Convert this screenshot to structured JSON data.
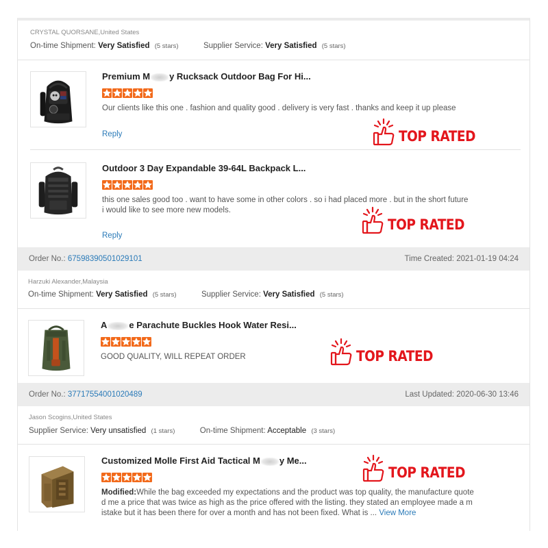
{
  "reviews": [
    {
      "reviewer": "CRYSTAL QUORSANE,United States",
      "ratings": [
        {
          "label": "On-time Shipment:",
          "value": "Very Satisfied",
          "stars": "(5 stars)"
        },
        {
          "label": "Supplier Service:",
          "value": "Very Satisfied",
          "stars": "(5 stars)"
        }
      ],
      "items": [
        {
          "title_a": "Premium M",
          "title_b": "y Rucksack Outdoor Bag For Hi...",
          "rating": 5,
          "text": "Our clients like this one . fashion and quality good .   delivery is very fast .  thanks and keep it up please",
          "reply": "Reply",
          "badge": "TOP RATED"
        },
        {
          "title": "Outdoor 3 Day Expandable 39-64L Backpack L...",
          "rating": 5,
          "text_line1": "this one sales good too .  want to have some in other colors . so i had placed more .  but in the short future",
          "text_line2": "i would like to see more new models.",
          "reply": "Reply",
          "badge": "TOP RATED"
        }
      ]
    },
    {
      "order_label": "Order No.:",
      "order_no": "67598390501029101",
      "time_label": "Time Created:",
      "time": "2021-01-19 04:24",
      "reviewer": "Harzuki Alexander,Malaysia",
      "ratings": [
        {
          "label": "On-time Shipment:",
          "value": "Very Satisfied",
          "stars": "(5 stars)"
        },
        {
          "label": "Supplier Service:",
          "value": "Very Satisfied",
          "stars": "(5 stars)"
        }
      ],
      "items": [
        {
          "title_a": "A",
          "title_b": "e Parachute Buckles Hook Water Resi...",
          "rating": 5,
          "text": "GOOD QUALITY, WILL REPEAT ORDER",
          "badge": "TOP RATED"
        }
      ]
    },
    {
      "order_label": "Order No.:",
      "order_no": "37717554001020489",
      "time_label": "Last Updated:",
      "time": "2020-06-30 13:46",
      "reviewer": "Jason Scogins,United States",
      "ratings": [
        {
          "label": "Supplier Service:",
          "value": "Very unsatisfied",
          "stars": "(1 stars)"
        },
        {
          "label": "On-time Shipment:",
          "value": "Acceptable",
          "stars": "(3 stars)"
        }
      ],
      "items": [
        {
          "title_a": "Customized Molle First Aid Tactical M",
          "title_b": "y Me...",
          "rating": 5,
          "modified_label": "Modified:",
          "text_line1": "While the bag exceeded my expectations and the product was top quality, the manufacture quote",
          "text_line2": "d me a price that was twice as high as the price offered with the listing.  they stated an employee made a m",
          "text_line3": "istake but it has been there for over a month and has not been fixed.  What is ...",
          "view_more": "View More",
          "badge": "TOP RATED"
        }
      ]
    }
  ],
  "colors": {
    "star": "#f26a1b",
    "badge": "#e3161c",
    "link": "#2a7ab8"
  }
}
